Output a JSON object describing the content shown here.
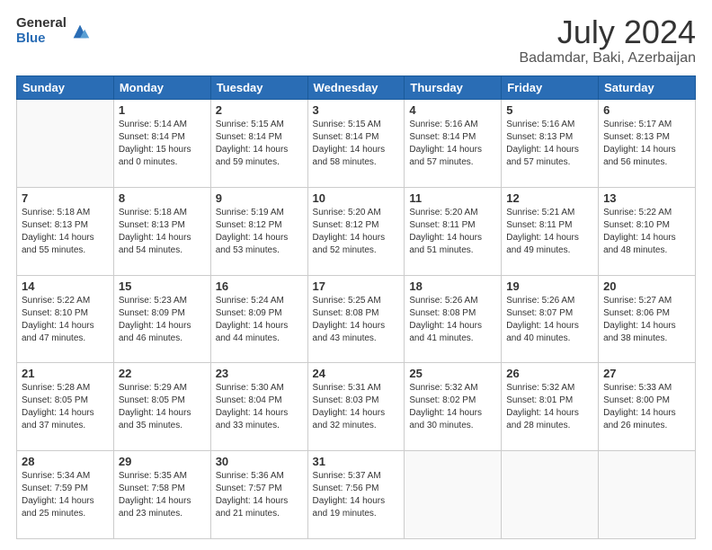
{
  "logo": {
    "general": "General",
    "blue": "Blue"
  },
  "header": {
    "month": "July 2024",
    "location": "Badamdar, Baki, Azerbaijan"
  },
  "days_of_week": [
    "Sunday",
    "Monday",
    "Tuesday",
    "Wednesday",
    "Thursday",
    "Friday",
    "Saturday"
  ],
  "weeks": [
    [
      {
        "day": "",
        "info": ""
      },
      {
        "day": "1",
        "info": "Sunrise: 5:14 AM\nSunset: 8:14 PM\nDaylight: 15 hours\nand 0 minutes."
      },
      {
        "day": "2",
        "info": "Sunrise: 5:15 AM\nSunset: 8:14 PM\nDaylight: 14 hours\nand 59 minutes."
      },
      {
        "day": "3",
        "info": "Sunrise: 5:15 AM\nSunset: 8:14 PM\nDaylight: 14 hours\nand 58 minutes."
      },
      {
        "day": "4",
        "info": "Sunrise: 5:16 AM\nSunset: 8:14 PM\nDaylight: 14 hours\nand 57 minutes."
      },
      {
        "day": "5",
        "info": "Sunrise: 5:16 AM\nSunset: 8:13 PM\nDaylight: 14 hours\nand 57 minutes."
      },
      {
        "day": "6",
        "info": "Sunrise: 5:17 AM\nSunset: 8:13 PM\nDaylight: 14 hours\nand 56 minutes."
      }
    ],
    [
      {
        "day": "7",
        "info": "Sunrise: 5:18 AM\nSunset: 8:13 PM\nDaylight: 14 hours\nand 55 minutes."
      },
      {
        "day": "8",
        "info": "Sunrise: 5:18 AM\nSunset: 8:13 PM\nDaylight: 14 hours\nand 54 minutes."
      },
      {
        "day": "9",
        "info": "Sunrise: 5:19 AM\nSunset: 8:12 PM\nDaylight: 14 hours\nand 53 minutes."
      },
      {
        "day": "10",
        "info": "Sunrise: 5:20 AM\nSunset: 8:12 PM\nDaylight: 14 hours\nand 52 minutes."
      },
      {
        "day": "11",
        "info": "Sunrise: 5:20 AM\nSunset: 8:11 PM\nDaylight: 14 hours\nand 51 minutes."
      },
      {
        "day": "12",
        "info": "Sunrise: 5:21 AM\nSunset: 8:11 PM\nDaylight: 14 hours\nand 49 minutes."
      },
      {
        "day": "13",
        "info": "Sunrise: 5:22 AM\nSunset: 8:10 PM\nDaylight: 14 hours\nand 48 minutes."
      }
    ],
    [
      {
        "day": "14",
        "info": "Sunrise: 5:22 AM\nSunset: 8:10 PM\nDaylight: 14 hours\nand 47 minutes."
      },
      {
        "day": "15",
        "info": "Sunrise: 5:23 AM\nSunset: 8:09 PM\nDaylight: 14 hours\nand 46 minutes."
      },
      {
        "day": "16",
        "info": "Sunrise: 5:24 AM\nSunset: 8:09 PM\nDaylight: 14 hours\nand 44 minutes."
      },
      {
        "day": "17",
        "info": "Sunrise: 5:25 AM\nSunset: 8:08 PM\nDaylight: 14 hours\nand 43 minutes."
      },
      {
        "day": "18",
        "info": "Sunrise: 5:26 AM\nSunset: 8:08 PM\nDaylight: 14 hours\nand 41 minutes."
      },
      {
        "day": "19",
        "info": "Sunrise: 5:26 AM\nSunset: 8:07 PM\nDaylight: 14 hours\nand 40 minutes."
      },
      {
        "day": "20",
        "info": "Sunrise: 5:27 AM\nSunset: 8:06 PM\nDaylight: 14 hours\nand 38 minutes."
      }
    ],
    [
      {
        "day": "21",
        "info": "Sunrise: 5:28 AM\nSunset: 8:05 PM\nDaylight: 14 hours\nand 37 minutes."
      },
      {
        "day": "22",
        "info": "Sunrise: 5:29 AM\nSunset: 8:05 PM\nDaylight: 14 hours\nand 35 minutes."
      },
      {
        "day": "23",
        "info": "Sunrise: 5:30 AM\nSunset: 8:04 PM\nDaylight: 14 hours\nand 33 minutes."
      },
      {
        "day": "24",
        "info": "Sunrise: 5:31 AM\nSunset: 8:03 PM\nDaylight: 14 hours\nand 32 minutes."
      },
      {
        "day": "25",
        "info": "Sunrise: 5:32 AM\nSunset: 8:02 PM\nDaylight: 14 hours\nand 30 minutes."
      },
      {
        "day": "26",
        "info": "Sunrise: 5:32 AM\nSunset: 8:01 PM\nDaylight: 14 hours\nand 28 minutes."
      },
      {
        "day": "27",
        "info": "Sunrise: 5:33 AM\nSunset: 8:00 PM\nDaylight: 14 hours\nand 26 minutes."
      }
    ],
    [
      {
        "day": "28",
        "info": "Sunrise: 5:34 AM\nSunset: 7:59 PM\nDaylight: 14 hours\nand 25 minutes."
      },
      {
        "day": "29",
        "info": "Sunrise: 5:35 AM\nSunset: 7:58 PM\nDaylight: 14 hours\nand 23 minutes."
      },
      {
        "day": "30",
        "info": "Sunrise: 5:36 AM\nSunset: 7:57 PM\nDaylight: 14 hours\nand 21 minutes."
      },
      {
        "day": "31",
        "info": "Sunrise: 5:37 AM\nSunset: 7:56 PM\nDaylight: 14 hours\nand 19 minutes."
      },
      {
        "day": "",
        "info": ""
      },
      {
        "day": "",
        "info": ""
      },
      {
        "day": "",
        "info": ""
      }
    ]
  ]
}
